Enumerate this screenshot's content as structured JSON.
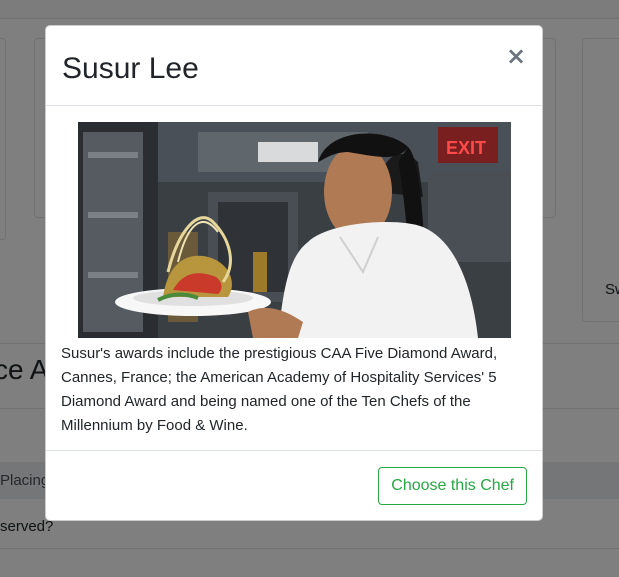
{
  "background": {
    "card_text": "Sw",
    "section_heading": "ce A",
    "row1": "Placing",
    "row2": "served?"
  },
  "modal": {
    "title": "Susur Lee",
    "close_glyph": "×",
    "photo_sign": "EXIT",
    "bio": "Susur's awards include the prestigious CAA Five Diamond Award, Cannes, France; the American Academy of Hospitality Services' 5 Diamond Award and being named one of the Ten Chefs of the Millennium by Food & Wine.",
    "choose_label": "Choose this Chef"
  },
  "colors": {
    "accent": "#28a745",
    "backdrop": "rgba(0,0,0,0.5)"
  }
}
